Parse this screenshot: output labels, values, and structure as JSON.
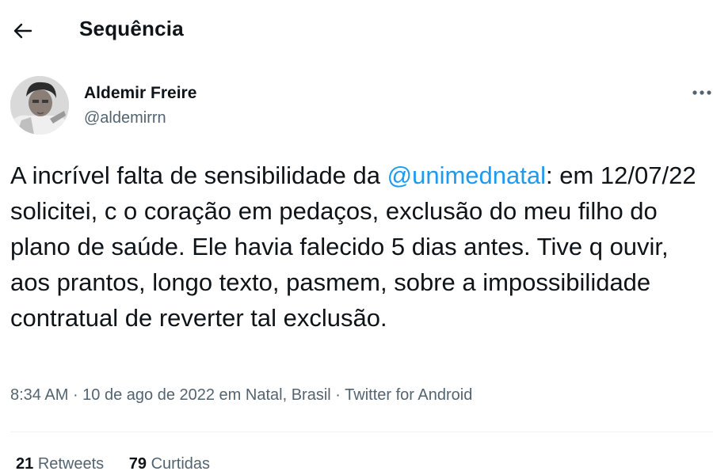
{
  "header": {
    "back_icon": "arrow-left-icon",
    "title": "Sequência"
  },
  "author": {
    "avatar_icon": "user-avatar",
    "name": "Aldemir Freire",
    "handle": "@aldemirrn"
  },
  "menu": {
    "more_icon": "ellipsis-icon"
  },
  "tweet": {
    "text_before_mention": "A incrível falta de sensibilidade da ",
    "mention": "@unimednatal",
    "text_after_mention": ": em 12/07/22 solicitei, c o coração em pedaços, exclusão do meu filho do plano de saúde. Ele havia falecido 5 dias antes. Tive q ouvir, aos prantos, longo texto, pasmem, sobre a impossibilidade contratual de reverter tal exclusão."
  },
  "meta": {
    "time": "8:34 AM",
    "separator1": " · ",
    "date": "10 de ago de 2022",
    "location_prefix": " em ",
    "location": "Natal, Brasil",
    "separator2": " · ",
    "source": "Twitter for Android"
  },
  "stats": {
    "retweets_count": "21",
    "retweets_label": "Retweets",
    "likes_count": "79",
    "likes_label": "Curtidas"
  },
  "colors": {
    "accent": "#1d9bf0",
    "secondary_text": "#536471",
    "primary_text": "#0f1419"
  }
}
